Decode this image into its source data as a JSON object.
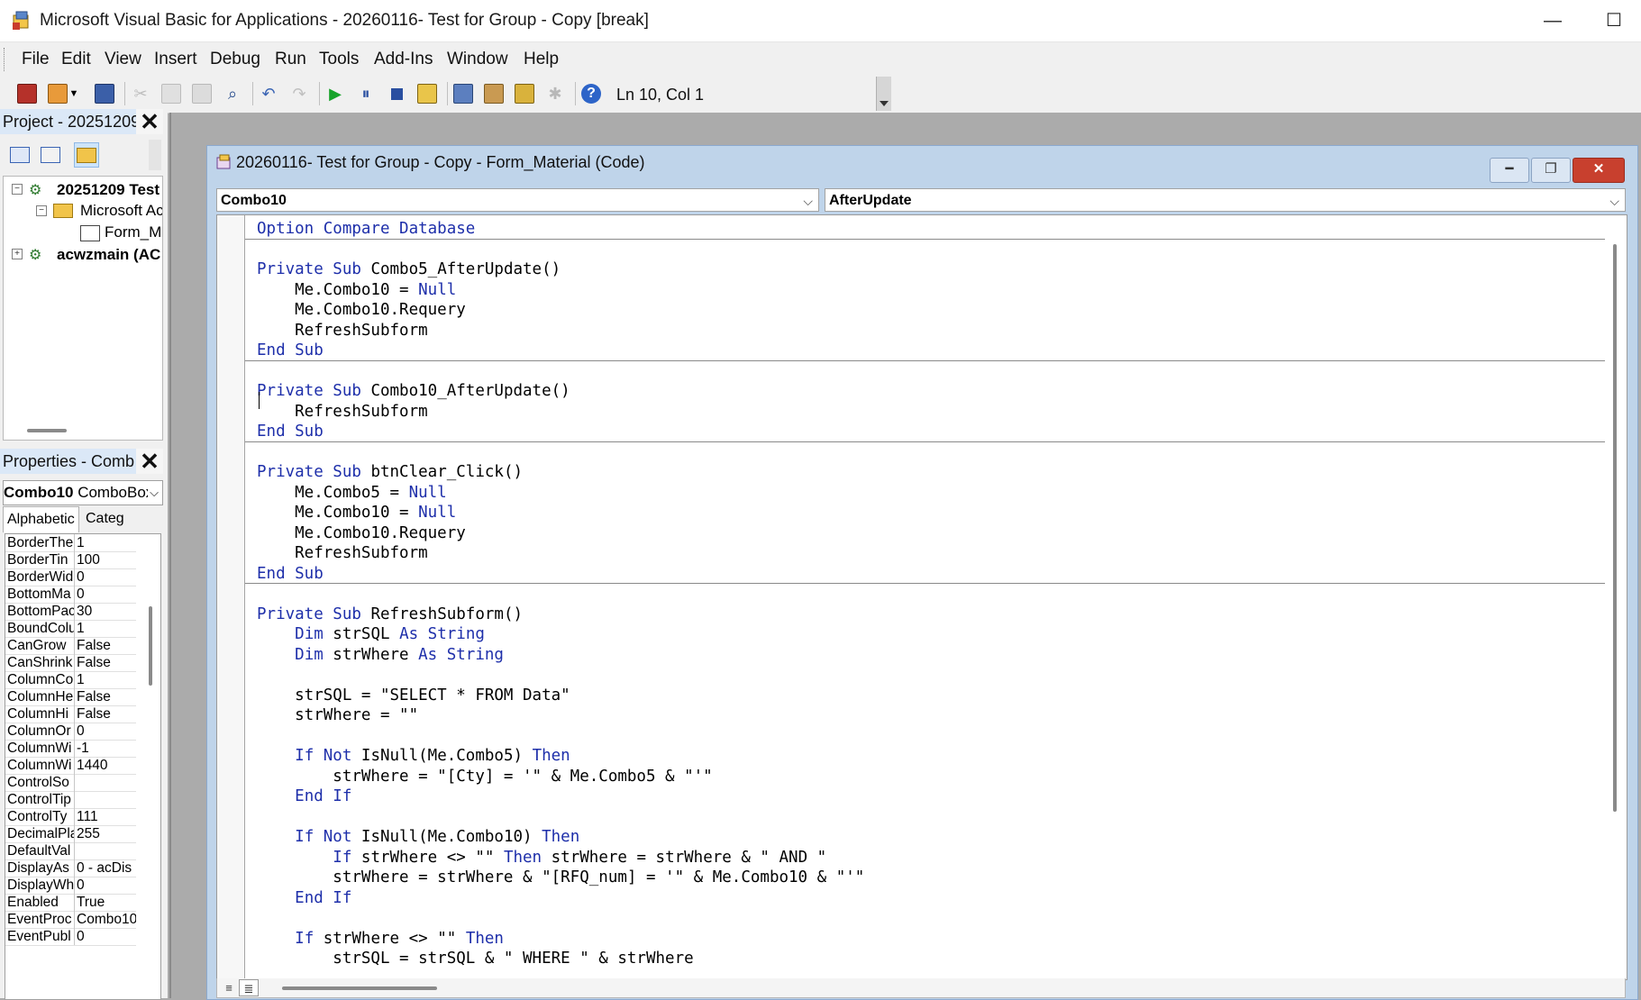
{
  "window": {
    "title": "Microsoft Visual Basic for Applications - 20260116- Test for Group - Copy [break]",
    "minimize": "—",
    "maximize": "☐"
  },
  "menu": [
    {
      "label": "File"
    },
    {
      "label": "Edit"
    },
    {
      "label": "View"
    },
    {
      "label": "Insert"
    },
    {
      "label": "Debug"
    },
    {
      "label": "Run"
    },
    {
      "label": "Tools"
    },
    {
      "label": "Add-Ins"
    },
    {
      "label": "Window"
    },
    {
      "label": "Help"
    }
  ],
  "toolbar": {
    "status": "Ln 10, Col 1",
    "icons": [
      "access-icon",
      "insert-userform-icon",
      "save-icon",
      "cut-icon",
      "copy-icon",
      "paste-icon",
      "find-icon",
      "undo-icon",
      "redo-icon",
      "run-icon",
      "break-icon",
      "reset-icon",
      "design-mode-icon",
      "project-explorer-icon",
      "properties-window-icon",
      "object-browser-icon",
      "toolbox-icon",
      "help-icon"
    ]
  },
  "project_pane": {
    "title": "Project - 20251209",
    "close": "✕",
    "tree": [
      {
        "label": "20251209 Test",
        "bold": true,
        "level": 0,
        "expander": "−"
      },
      {
        "label": "Microsoft Acc",
        "bold": false,
        "level": 1,
        "expander": "−"
      },
      {
        "label": "Form_Ma",
        "bold": false,
        "level": 2,
        "expander": ""
      },
      {
        "label": "acwzmain (AC",
        "bold": true,
        "level": 0,
        "expander": "+"
      }
    ]
  },
  "properties_pane": {
    "title": "Properties - Comb",
    "close": "✕",
    "object_name": "Combo10",
    "object_type": "ComboBox",
    "tabs": [
      "Alphabetic",
      "Categ"
    ],
    "rows": [
      {
        "name": "BorderThe",
        "value": "1"
      },
      {
        "name": "BorderTin",
        "value": "100"
      },
      {
        "name": "BorderWid",
        "value": "0"
      },
      {
        "name": "BottomMa",
        "value": "0"
      },
      {
        "name": "BottomPac",
        "value": "30"
      },
      {
        "name": "BoundColu",
        "value": "1"
      },
      {
        "name": "CanGrow",
        "value": "False"
      },
      {
        "name": "CanShrink",
        "value": "False"
      },
      {
        "name": "ColumnCo",
        "value": "1"
      },
      {
        "name": "ColumnHe",
        "value": "False"
      },
      {
        "name": "ColumnHi",
        "value": "False"
      },
      {
        "name": "ColumnOr",
        "value": "0"
      },
      {
        "name": "ColumnWi",
        "value": "-1"
      },
      {
        "name": "ColumnWi",
        "value": "1440"
      },
      {
        "name": "ControlSo",
        "value": ""
      },
      {
        "name": "ControlTip",
        "value": ""
      },
      {
        "name": "ControlTy",
        "value": "111"
      },
      {
        "name": "DecimalPla",
        "value": "255"
      },
      {
        "name": "DefaultVal",
        "value": ""
      },
      {
        "name": "DisplayAs",
        "value": "0 - acDis"
      },
      {
        "name": "DisplayWh",
        "value": "0"
      },
      {
        "name": "Enabled",
        "value": "True"
      },
      {
        "name": "EventProc",
        "value": "Combo10"
      },
      {
        "name": "EventPubl",
        "value": "0"
      }
    ]
  },
  "code_window": {
    "title": "20260116- Test for Group - Copy - Form_Material (Code)",
    "object_dropdown": "Combo10",
    "procedure_dropdown": "AfterUpdate",
    "lines": [
      [
        {
          "t": "Option Compare Database",
          "k": true
        }
      ],
      [],
      [
        {
          "t": "Private Sub ",
          "k": true
        },
        {
          "t": "Combo5_AfterUpdate()"
        }
      ],
      [
        {
          "t": "    Me.Combo10 = "
        },
        {
          "t": "Null",
          "k": true
        }
      ],
      [
        {
          "t": "    Me.Combo10.Requery"
        }
      ],
      [
        {
          "t": "    RefreshSubform"
        }
      ],
      [
        {
          "t": "End Sub",
          "k": true
        }
      ],
      [],
      [
        {
          "t": "Private Sub ",
          "k": true
        },
        {
          "t": "Combo10_AfterUpdate()"
        }
      ],
      [
        {
          "t": "    RefreshSubform"
        }
      ],
      [
        {
          "t": "End Sub",
          "k": true
        }
      ],
      [],
      [
        {
          "t": "Private Sub ",
          "k": true
        },
        {
          "t": "btnClear_Click()"
        }
      ],
      [
        {
          "t": "    Me.Combo5 = "
        },
        {
          "t": "Null",
          "k": true
        }
      ],
      [
        {
          "t": "    Me.Combo10 = "
        },
        {
          "t": "Null",
          "k": true
        }
      ],
      [
        {
          "t": "    Me.Combo10.Requery"
        }
      ],
      [
        {
          "t": "    RefreshSubform"
        }
      ],
      [
        {
          "t": "End Sub",
          "k": true
        }
      ],
      [],
      [
        {
          "t": "Private Sub ",
          "k": true
        },
        {
          "t": "RefreshSubform()"
        }
      ],
      [
        {
          "t": "    "
        },
        {
          "t": "Dim",
          "k": true
        },
        {
          "t": " strSQL "
        },
        {
          "t": "As String",
          "k": true
        }
      ],
      [
        {
          "t": "    "
        },
        {
          "t": "Dim",
          "k": true
        },
        {
          "t": " strWhere "
        },
        {
          "t": "As String",
          "k": true
        }
      ],
      [],
      [
        {
          "t": "    strSQL = \"SELECT * FROM Data\""
        }
      ],
      [
        {
          "t": "    strWhere = \"\""
        }
      ],
      [],
      [
        {
          "t": "    "
        },
        {
          "t": "If Not",
          "k": true
        },
        {
          "t": " IsNull(Me.Combo5) "
        },
        {
          "t": "Then",
          "k": true
        }
      ],
      [
        {
          "t": "        strWhere = \"[Cty] = '\" & Me.Combo5 & \"'\""
        }
      ],
      [
        {
          "t": "    "
        },
        {
          "t": "End If",
          "k": true
        }
      ],
      [],
      [
        {
          "t": "    "
        },
        {
          "t": "If Not",
          "k": true
        },
        {
          "t": " IsNull(Me.Combo10) "
        },
        {
          "t": "Then",
          "k": true
        }
      ],
      [
        {
          "t": "        "
        },
        {
          "t": "If",
          "k": true
        },
        {
          "t": " strWhere <> \"\" "
        },
        {
          "t": "Then",
          "k": true
        },
        {
          "t": " strWhere = strWhere & \" AND \""
        }
      ],
      [
        {
          "t": "        strWhere = strWhere & \"[RFQ_num] = '\" & Me.Combo10 & \"'\""
        }
      ],
      [
        {
          "t": "    "
        },
        {
          "t": "End If",
          "k": true
        }
      ],
      [],
      [
        {
          "t": "    "
        },
        {
          "t": "If",
          "k": true
        },
        {
          "t": " strWhere <> \"\" "
        },
        {
          "t": "Then",
          "k": true
        }
      ],
      [
        {
          "t": "        strSQL = strSQL & \" WHERE \" & strWhere"
        }
      ]
    ],
    "separators_after": [
      0,
      6,
      10,
      17
    ]
  }
}
